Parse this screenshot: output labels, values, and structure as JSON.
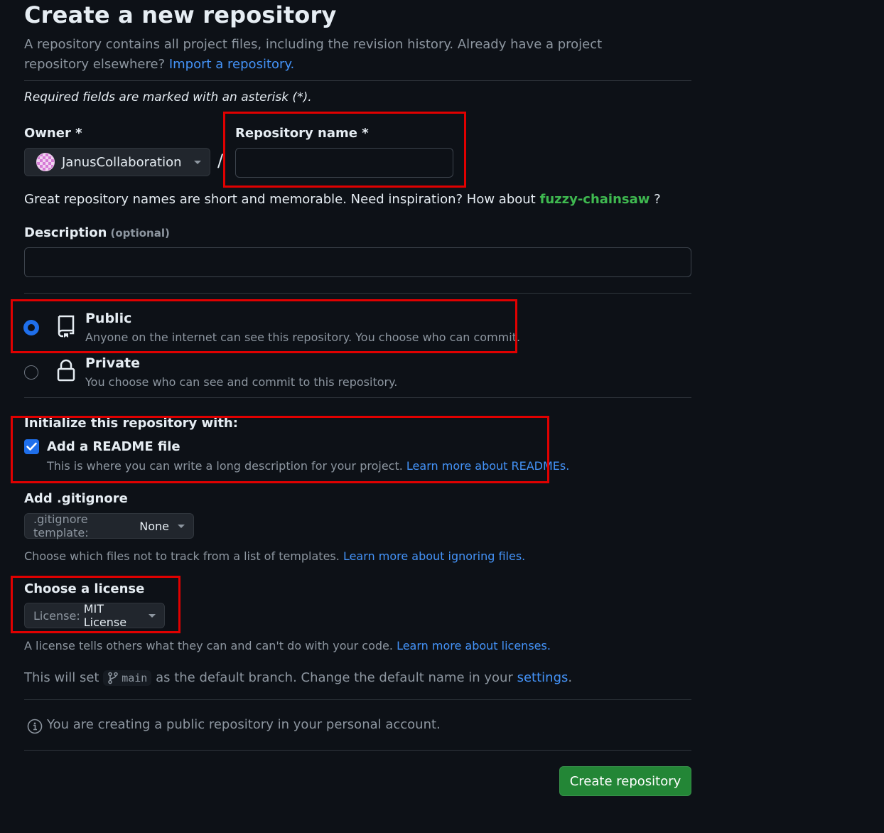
{
  "header": {
    "title": "Create a new repository",
    "subtitle": "A repository contains all project files, including the revision history. Already have a project repository elsewhere?",
    "import_link": "Import a repository."
  },
  "required_note": "Required fields are marked with an asterisk (*).",
  "owner": {
    "label": "Owner *",
    "value": "JanusCollaboration"
  },
  "separator": "/",
  "repo_name": {
    "label": "Repository name *",
    "value": "",
    "placeholder": ""
  },
  "name_hint": {
    "text": "Great repository names are short and memorable. Need inspiration? How about",
    "suggestion": "fuzzy-chainsaw",
    "tail": "?"
  },
  "description": {
    "label": "Description",
    "optional": "(optional)",
    "value": ""
  },
  "visibility": {
    "public": {
      "title": "Public",
      "desc": "Anyone on the internet can see this repository. You choose who can commit.",
      "selected": true
    },
    "private": {
      "title": "Private",
      "desc": "You choose who can see and commit to this repository.",
      "selected": false
    }
  },
  "initialize": {
    "heading": "Initialize this repository with:",
    "readme_label": "Add a README file",
    "readme_checked": true,
    "readme_desc": "This is where you can write a long description for your project.",
    "readme_link": "Learn more about READMEs."
  },
  "gitignore": {
    "label": "Add .gitignore",
    "prefix": ".gitignore template:",
    "value": "None",
    "note": "Choose which files not to track from a list of templates.",
    "note_link": "Learn more about ignoring files."
  },
  "license": {
    "label": "Choose a license",
    "prefix": "License:",
    "value": "MIT License",
    "note": "A license tells others what they can and can't do with your code.",
    "note_link": "Learn more about licenses."
  },
  "branch": {
    "pre": "This will set",
    "name": "main",
    "post": "as the default branch. Change the default name in your",
    "settings_link": "settings",
    "end": "."
  },
  "info_note": "You are creating a public repository in your personal account.",
  "create_button": "Create repository",
  "colors": {
    "background": "#0d1117",
    "accent": "#1f6feb",
    "link": "#4493f8",
    "create_button": "#238636",
    "suggestion": "#3fb950",
    "highlight_box": "#e00000"
  }
}
